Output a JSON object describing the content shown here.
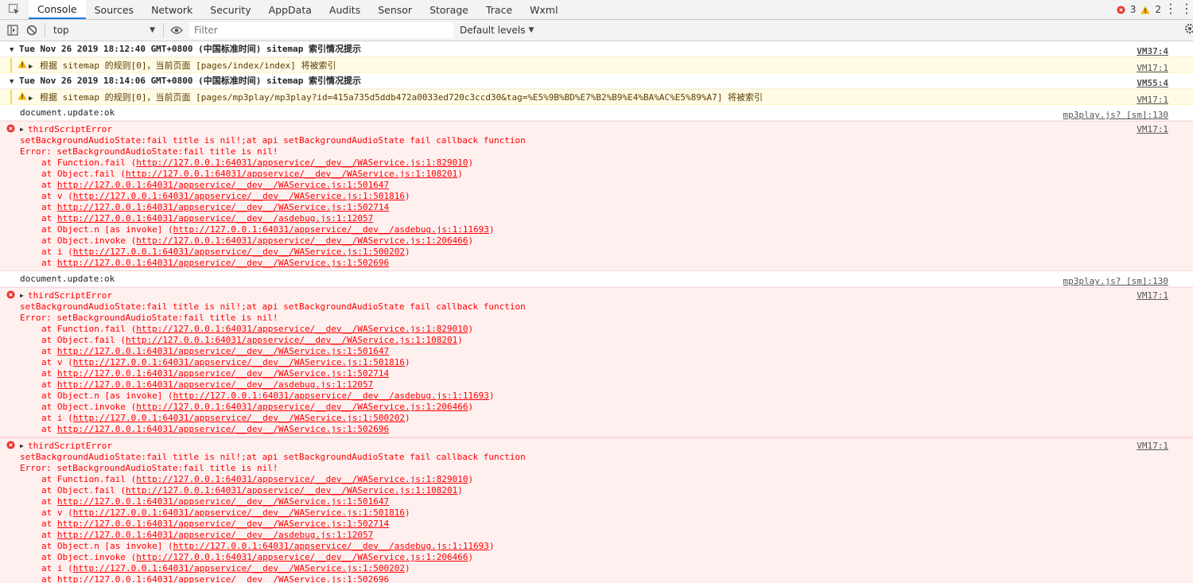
{
  "tabs": [
    "Console",
    "Sources",
    "Network",
    "Security",
    "AppData",
    "Audits",
    "Sensor",
    "Storage",
    "Trace",
    "Wxml"
  ],
  "active_tab": "Console",
  "counters": {
    "errors": "3",
    "warnings": "2"
  },
  "toolbar": {
    "context": "top",
    "filter_placeholder": "Filter",
    "levels": "Default levels"
  },
  "groups": [
    {
      "text": "Tue Nov 26 2019 18:12:40 GMT+0800 (中国标准时间) sitemap 索引情况提示",
      "src": "VM37:4",
      "warn": "根据 sitemap 的规则[0]，当前页面 [pages/index/index] 将被索引",
      "warn_src": "VM17:1"
    },
    {
      "text": "Tue Nov 26 2019 18:14:06 GMT+0800 (中国标准时间) sitemap 索引情况提示",
      "src": "VM55:4",
      "warn": "根据 sitemap 的规则[0]，当前页面 [pages/mp3play/mp3play?id=415a735d5ddb472a0033ed720c3ccd30&tag=%E5%9B%BD%E7%B2%B9%E4%BA%AC%E5%89%A7] 将被索引",
      "warn_src": "VM17:1"
    }
  ],
  "log": {
    "text": "document.update:ok",
    "src": "mp3play.js? [sm]:130"
  },
  "error": {
    "src": "VM17:1",
    "title": "thirdScriptError",
    "message": "setBackgroundAudioState:fail title is nil!;at api setBackgroundAudioState fail callback function",
    "error_line": "Error: setBackgroundAudioState:fail title is nil!",
    "stack": [
      {
        "pre": "at Function.fail (",
        "url": "http://127.0.0.1:64031/appservice/__dev__/WAService.js:1:829010",
        "post": ")"
      },
      {
        "pre": "at Object.fail (",
        "url": "http://127.0.0.1:64031/appservice/__dev__/WAService.js:1:108201",
        "post": ")"
      },
      {
        "pre": "at ",
        "url": "http://127.0.0.1:64031/appservice/__dev__/WAService.js:1:501647",
        "post": ""
      },
      {
        "pre": "at v (",
        "url": "http://127.0.0.1:64031/appservice/__dev__/WAService.js:1:501816",
        "post": ")"
      },
      {
        "pre": "at ",
        "url": "http://127.0.0.1:64031/appservice/__dev__/WAService.js:1:502714",
        "post": ""
      },
      {
        "pre": "at ",
        "url": "http://127.0.0.1:64031/appservice/__dev__/asdebug.js:1:12057",
        "post": ""
      },
      {
        "pre": "at Object.n [as invoke] (",
        "url": "http://127.0.0.1:64031/appservice/__dev__/asdebug.js:1:11693",
        "post": ")"
      },
      {
        "pre": "at Object.invoke (",
        "url": "http://127.0.0.1:64031/appservice/__dev__/WAService.js:1:206466",
        "post": ")"
      },
      {
        "pre": "at i (",
        "url": "http://127.0.0.1:64031/appservice/__dev__/WAService.js:1:500202",
        "post": ")"
      },
      {
        "pre": "at ",
        "url": "http://127.0.0.1:64031/appservice/__dev__/WAService.js:1:502696",
        "post": ""
      }
    ]
  },
  "sequence": [
    "group0",
    "group1",
    "log",
    "error",
    "log",
    "error",
    "error"
  ]
}
